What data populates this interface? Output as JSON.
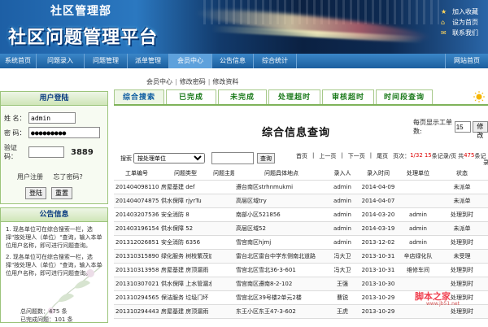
{
  "header": {
    "site_small": "社区管理部",
    "site_big": "社区问题管理平台",
    "links": [
      {
        "label": "加入收藏",
        "icon": "star-icon"
      },
      {
        "label": "设为首页",
        "icon": "home-icon"
      },
      {
        "label": "联系我们",
        "icon": "mail-icon"
      }
    ]
  },
  "nav": {
    "items": [
      "系统首页",
      "问题录入",
      "问题管理",
      "派单管理",
      "会员中心",
      "公告信息",
      "综合统计"
    ],
    "active_index": 4,
    "right_item": "网站首页"
  },
  "subnav": {
    "items": [
      "会员中心",
      "修改密码",
      "修改资料"
    ]
  },
  "login": {
    "title": "用户登陆",
    "name_label": "姓  名：",
    "name_value": "admin",
    "password_label": "密  码：",
    "password_value": "●●●●●●●●●",
    "captcha_label": "验证码：",
    "captcha_value": "",
    "captcha_code": "3889",
    "register_link": "用户注册",
    "forgot_link": "忘了密码?",
    "login_button": "登陆",
    "reset_button": "重置"
  },
  "notice": {
    "title": "公告信息",
    "paragraphs": [
      "1. 现各单位可在综合搜索一栏，选择\"按处理人（单位）\"查询，输入本单位用户名称，即可进行问题查询。",
      "2. 现各单位可在综合搜索一栏，选择\"按处理人（单位）\"查询，输入本单位用户名称，即可进行问题查询。"
    ],
    "stats": [
      "总问题数：475 条",
      "已完成问题：101 条"
    ]
  },
  "tabs": {
    "items": [
      "综合搜索",
      "已完成",
      "未完成",
      "处理超时",
      "审核超时",
      "时间段查询"
    ],
    "active_index": 0
  },
  "main": {
    "title": "综合信息查询",
    "page_size_label": "每页显示工单数:",
    "page_size_value": "15",
    "page_size_button": "修改",
    "search_label": "搜索",
    "search_select": "按处理单位",
    "search_value": "",
    "search_button": "查询",
    "pager": {
      "first": "首页",
      "prev": "上一页",
      "next": "下一页",
      "last": "尾页",
      "page_info_prefix": "页次：",
      "page_info": "1/32",
      "per_page": "15",
      "per_page_suffix": "条记录/页",
      "total_prefix": "共",
      "total": "475",
      "total_suffix": "条记",
      "records_wrap": "录"
    }
  },
  "table": {
    "headers": [
      "工单编号",
      "问题类型",
      "问题主题",
      "问题具体地点",
      "录入人",
      "录入时间",
      "处理单位",
      "状态"
    ],
    "rows": [
      [
        "201404098110",
        "房屋基建 def",
        "",
        "遵台南区strhnmukmi",
        "admin",
        "2014-04-09",
        "",
        "未派单"
      ],
      [
        "201404074875",
        "供水保障 rjyrTu",
        "",
        "高层区域try",
        "admin",
        "2014-04-07",
        "",
        "未派单"
      ],
      [
        "201403207536",
        "安全消防 8",
        "",
        "南部小区521856",
        "admin",
        "2014-03-20",
        "admin",
        "处理到时"
      ],
      [
        "201403196154",
        "供水保障 52",
        "",
        "高层区域52",
        "admin",
        "2014-03-19",
        "admin",
        "未派单"
      ],
      [
        "201312026851",
        "安全消防 6356",
        "",
        "雪宫南区hjmj",
        "admin",
        "2013-12-02",
        "admin",
        "处理到时"
      ],
      [
        "201310315890",
        "绿化服务 树枝繁茂遮挡路灯",
        "",
        "雷台北区雷台中学东侧南北道路",
        "冯大卫",
        "2013-10-31",
        "辛店绿化队",
        "未受理"
      ],
      [
        "201310313958",
        "房屋基建 房顶漏雨",
        "",
        "雪宫北区雪北36-3-601",
        "冯大卫",
        "2013-10-31",
        "维修车间",
        "处理到时"
      ],
      [
        "201310307021",
        "供水保障 上水管漏水",
        "",
        "雪宫南区遵南8-2-102",
        "王强",
        "2013-10-30",
        "",
        "处理到时"
      ],
      [
        "201310294565",
        "保洁服务 垃圾门坏",
        "",
        "雪宫北区39号楼2单元2楼",
        "曹锐",
        "2013-10-29",
        "",
        "处理到时"
      ],
      [
        "201310294443",
        "房屋基建 房顶漏雨",
        "",
        "东王小区东王47-3-602",
        "王虎",
        "2013-10-29",
        "",
        "处理到时"
      ]
    ]
  },
  "watermark": {
    "main": "脚本之家",
    "sub": "www.jb51.net"
  }
}
